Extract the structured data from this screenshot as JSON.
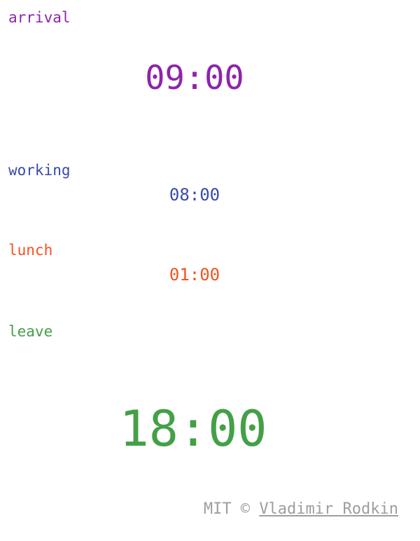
{
  "arrival": {
    "label": "arrival",
    "time": "09:00"
  },
  "working": {
    "label": "working",
    "time": "08:00"
  },
  "lunch": {
    "label": "lunch",
    "time": "01:00"
  },
  "leave": {
    "label": "leave",
    "time": "18:00"
  },
  "footer": {
    "license": "MIT ©",
    "author": "Vladimir Rodkin"
  },
  "colors": {
    "arrival": "#8e24aa",
    "working": "#3949ab",
    "lunch": "#f4511e",
    "leave": "#43a047",
    "footer": "#9e9e9e"
  }
}
